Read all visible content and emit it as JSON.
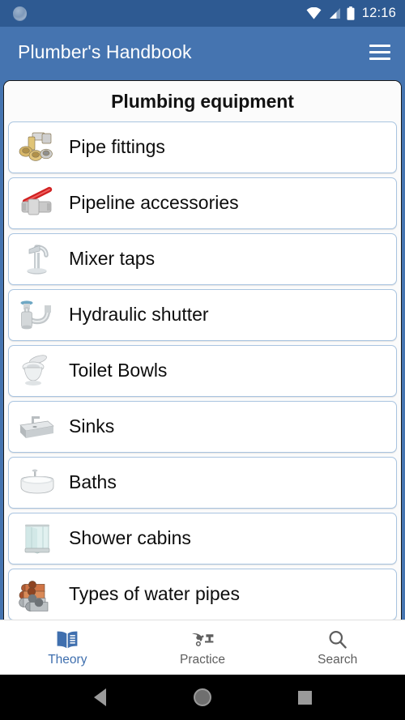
{
  "status_bar": {
    "notification_icon": "sync-circle-icon",
    "wifi_icon": "wifi-icon",
    "signal_icon": "cellular-signal-icon",
    "battery_icon": "battery-full-icon",
    "time": "12:16",
    "background_color": "#2e5a92"
  },
  "app_bar": {
    "title": "Plumber's Handbook",
    "menu_icon": "hamburger-menu-icon",
    "background_color": "#4574b0",
    "text_color": "#ffffff"
  },
  "panel": {
    "heading": "Plumbing equipment"
  },
  "list": {
    "items": [
      {
        "label": "Pipe fittings",
        "icon": "pipe-fittings-icon"
      },
      {
        "label": "Pipeline accessories",
        "icon": "ball-valve-icon"
      },
      {
        "label": "Mixer taps",
        "icon": "mixer-tap-icon"
      },
      {
        "label": "Hydraulic shutter",
        "icon": "siphon-trap-icon"
      },
      {
        "label": "Toilet Bowls",
        "icon": "toilet-bowl-icon"
      },
      {
        "label": "Sinks",
        "icon": "sink-icon"
      },
      {
        "label": "Baths",
        "icon": "bathtub-icon"
      },
      {
        "label": "Shower cabins",
        "icon": "shower-cabin-icon"
      },
      {
        "label": "Types of water pipes",
        "icon": "water-pipes-icon"
      }
    ]
  },
  "bottom_nav": {
    "active_index": 0,
    "active_color": "#3f6fae",
    "inactive_color": "#5e5e5e",
    "items": [
      {
        "label": "Theory",
        "icon": "open-book-icon"
      },
      {
        "label": "Practice",
        "icon": "wrench-faucet-icon"
      },
      {
        "label": "Search",
        "icon": "magnifier-icon"
      }
    ]
  },
  "system_nav": {
    "back_label": "back-button",
    "home_label": "home-button",
    "recents_label": "recents-button"
  }
}
